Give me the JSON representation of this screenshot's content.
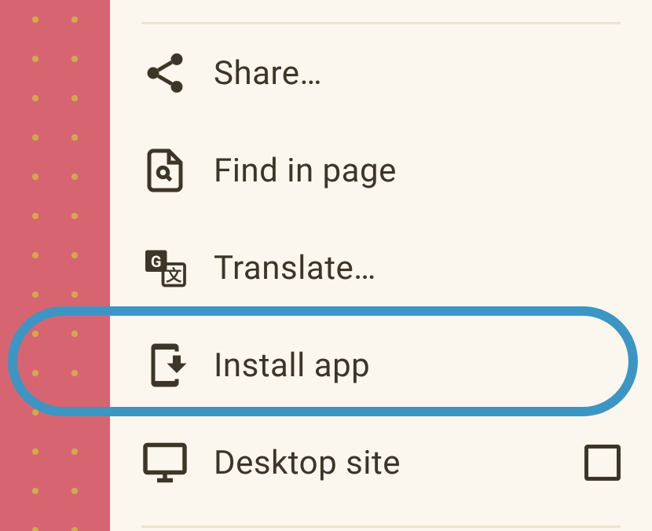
{
  "menu": {
    "items": [
      {
        "label": "Share…",
        "icon": "share"
      },
      {
        "label": "Find in page",
        "icon": "find"
      },
      {
        "label": "Translate…",
        "icon": "translate"
      },
      {
        "label": "Install app",
        "icon": "install",
        "highlighted": true
      },
      {
        "label": "Desktop site",
        "icon": "desktop",
        "checkbox": true,
        "checked": false
      }
    ]
  },
  "colors": {
    "background_red": "#d76571",
    "dot_gold": "#d4a74e",
    "panel_cream": "#fbf7ee",
    "text_dark": "#3d3528",
    "highlight_blue": "#3b96c4"
  }
}
